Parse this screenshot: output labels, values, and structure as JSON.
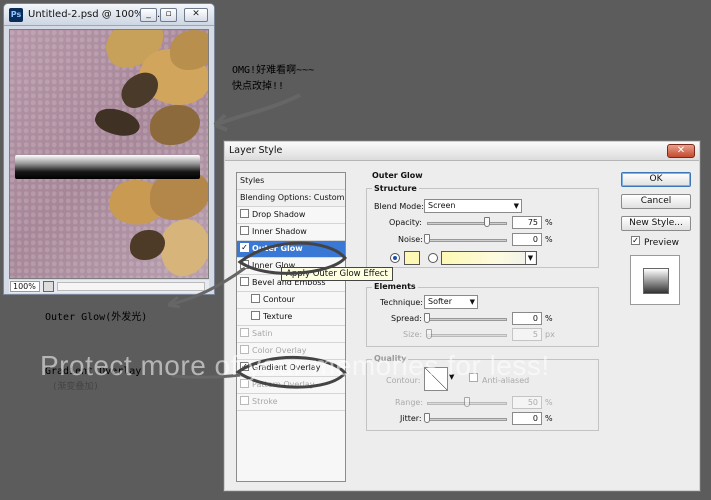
{
  "document_window": {
    "title": "Untitled-2.psd @ 100% (...",
    "app_icon_text": "Ps",
    "zoom": "100%",
    "buttons": {
      "minimize": "_",
      "restore": "▫",
      "close": "✕"
    }
  },
  "annotations": {
    "omg_line1": "OMG!好难看啊~~~",
    "omg_line2": "快点改掉!!",
    "outer_glow_note": "Outer Glow(外发光)",
    "gradient_note_line1": "Gradient Overlay",
    "gradient_note_line2": "(渐变叠加)"
  },
  "watermark": "Protect more of your memories for less!",
  "dialog": {
    "title": "Layer Style",
    "close": "✕",
    "style_list": [
      {
        "label": "Styles",
        "checkbox": false,
        "checked": false,
        "header": true
      },
      {
        "label": "Blending Options: Custom",
        "checkbox": false,
        "checked": false,
        "header": true
      },
      {
        "label": "Drop Shadow",
        "checkbox": true,
        "checked": false
      },
      {
        "label": "Inner Shadow",
        "checkbox": true,
        "checked": false
      },
      {
        "label": "Outer Glow",
        "checkbox": true,
        "checked": true,
        "selected": true
      },
      {
        "label": "Inner Glow",
        "checkbox": true,
        "checked": false
      },
      {
        "label": "Bevel and Emboss",
        "checkbox": true,
        "checked": false
      },
      {
        "label": "Contour",
        "checkbox": true,
        "checked": false,
        "indent": true
      },
      {
        "label": "Texture",
        "checkbox": true,
        "checked": false,
        "indent": true
      },
      {
        "label": "Satin",
        "checkbox": true,
        "checked": false,
        "dim": true
      },
      {
        "label": "Color Overlay",
        "checkbox": true,
        "checked": false,
        "dim": true
      },
      {
        "label": "Gradient Overlay",
        "checkbox": true,
        "checked": true
      },
      {
        "label": "Pattern Overlay",
        "checkbox": true,
        "checked": false,
        "dim": true
      },
      {
        "label": "Stroke",
        "checkbox": true,
        "checked": false,
        "dim": true
      }
    ],
    "tooltip": "Apply Outer Glow Effect",
    "outer_glow": {
      "section_title": "Outer Glow",
      "structure_title": "Structure",
      "blend_mode_label": "Blend Mode:",
      "blend_mode_value": "Screen",
      "opacity_label": "Opacity:",
      "opacity_value": "75",
      "opacity_level": 75,
      "noise_label": "Noise:",
      "noise_value": "0",
      "noise_level": 0,
      "percent": "%",
      "glow_color": "#fdf9b4",
      "elements_title": "Elements",
      "technique_label": "Technique:",
      "technique_value": "Softer",
      "spread_label": "Spread:",
      "spread_value": "0",
      "spread_level": 0,
      "size_label": "Size:",
      "size_value": "5",
      "size_level": 2,
      "px": "px",
      "quality_title": "Quality",
      "contour_label": "Contour:",
      "anti_aliased_label": "Anti-aliased",
      "range_label": "Range:",
      "range_value": "50",
      "range_level": 50,
      "jitter_label": "Jitter:",
      "jitter_value": "0",
      "jitter_level": 0
    },
    "buttons": {
      "ok": "OK",
      "cancel": "Cancel",
      "new_style": "New Style...",
      "preview_label": "Preview",
      "preview_checked": true
    }
  }
}
